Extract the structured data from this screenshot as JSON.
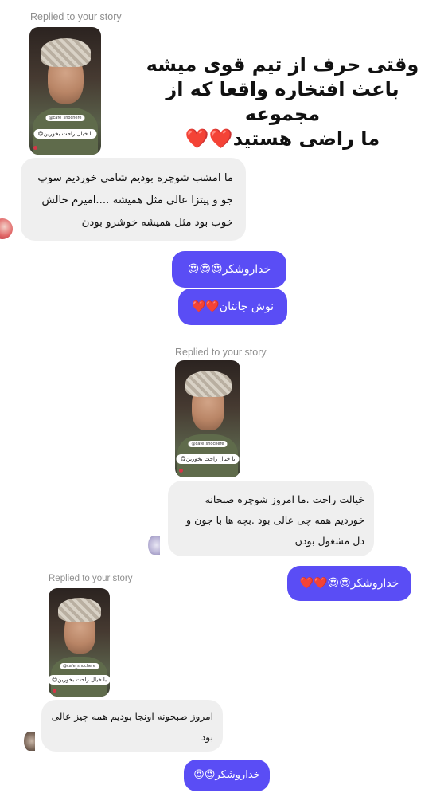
{
  "heading": {
    "line1": "وقتی حرف از تیم قوی میشه",
    "line2": "باعث افتخاره واقعا که از مجموعه",
    "line3": "ما راضی هستید❤️❤️"
  },
  "threads": [
    {
      "replied_label": "Replied to your story",
      "story_tag": "@cafe_shochere",
      "story_caption": "با خیال راحت بخورین😋",
      "message_lines": [
        "ما امشب شوچره بودیم شامی خوردیم سوپ",
        "جو و پیتزا عالی مثل همیشه ....امیرم حالش",
        "خوب بود مثل همیشه خوشرو بودن"
      ],
      "replies": [
        "خداروشکر😍😍😍",
        "نوش جانتان❤️❤️"
      ]
    },
    {
      "replied_label": "Replied to your story",
      "story_tag": "@cafe_shochere",
      "story_caption": "با خیال راحت بخورین😋",
      "message_lines": [
        "خیالت راحت .ما امروز شوچره صبحانه",
        "خوردیم همه چی عالی بود .بچه ها با جون و",
        "دل مشغول بودن"
      ],
      "replies": [
        "خداروشکر😍😍❤️❤️"
      ]
    },
    {
      "replied_label": "Replied to your story",
      "story_tag": "@cafe_shochere",
      "story_caption": "با خیال راحت بخورین😋",
      "message_lines": [
        "امروز صبحونه اونجا بودیم همه چیز عالی",
        "بود"
      ],
      "replies": [
        "خداروشکر😍😍"
      ]
    }
  ],
  "colors": {
    "sent_bubble": "#5a4df5",
    "received_bubble": "#efefef",
    "replied_label": "#8e8e8e"
  }
}
